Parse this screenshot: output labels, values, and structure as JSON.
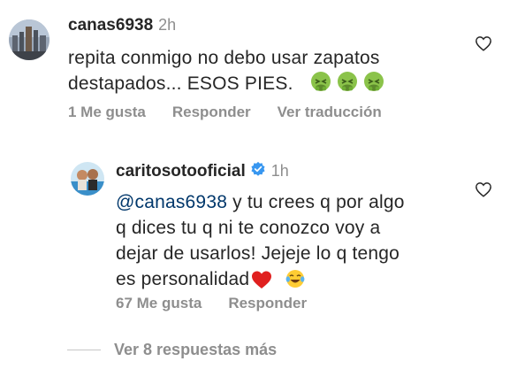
{
  "comment1": {
    "username": "canas6938",
    "time": "2h",
    "text_line1": "repita conmigo no debo usar zapatos",
    "text_line2": "destapados... ESOS PIES.",
    "emojis": [
      "nauseated-face",
      "nauseated-face",
      "nauseated-face"
    ],
    "likes_label": "1 Me gusta",
    "reply_label": "Responder",
    "translate_label": "Ver traducción"
  },
  "reply1": {
    "username": "caritosotooficial",
    "verified": true,
    "time": "1h",
    "mention": "@canas6938",
    "text_line1_rest": " y tu crees q por algo",
    "text_line2": "q dices tu q ni te conozco voy a",
    "text_line3": "dejar de usarlos! Jejeje lo q tengo",
    "text_line4": "es personalidad",
    "emojis": [
      "red-heart",
      "tears-of-joy"
    ],
    "likes_label": "67 Me gusta",
    "reply_label": "Responder"
  },
  "view_more": {
    "label": "Ver 8 respuestas más"
  },
  "colors": {
    "text": "#262626",
    "secondary": "#8e8e8e",
    "mention": "#00376b",
    "verified": "#3897f0"
  }
}
